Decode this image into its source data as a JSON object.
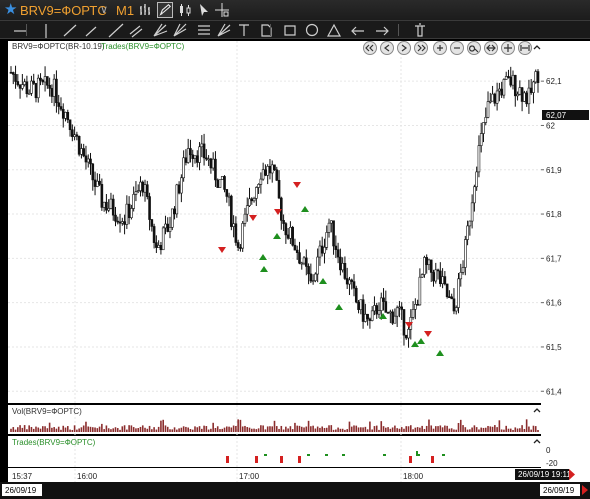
{
  "window": {
    "symbol": "BRV9=ФОРТС",
    "timeframe": "M1"
  },
  "main_pane": {
    "instrument_label": "BRV9=ФОРТС(BR-10.19)",
    "trades_label": "Trades(BRV9=ФОРТС)",
    "last_price": "62,07",
    "price_ticks": [
      "62,1",
      "62",
      "61,9",
      "61,8",
      "61,7",
      "61,6",
      "61,5",
      "61,4"
    ]
  },
  "vol_pane": {
    "label": "Vol(BRV9=ФОРТС)"
  },
  "trades_pane": {
    "label": "Trades(BRV9=ФОРТС)",
    "ticks": [
      "0",
      "-20"
    ]
  },
  "time_axis": {
    "start_label": "15:37",
    "ticks": [
      "16:00",
      "17:00",
      "18:00"
    ],
    "cursor_time": "26/09/19 19:11",
    "start_date": "26/09/19",
    "end_date": "26/09/19"
  },
  "colors": {
    "accent": "#f0a030",
    "up_marker": "#1e8f1e",
    "down_marker": "#d42020",
    "candle": "#e8e8e8",
    "volume": "#8b2d2d"
  },
  "toolbar_icons": [
    "bar-chart-icon",
    "pencil-icon",
    "candles-icon",
    "cursor-icon",
    "crosshair-icon"
  ],
  "drawing_tools": [
    "horizontal-line-icon",
    "vertical-line-icon",
    "trend-line-icon",
    "ray-icon",
    "extended-line-icon",
    "parallel-channel-icon",
    "andrews-pitchfork-icon",
    "gann-fan-icon",
    "fibonacci-icon",
    "fibonacci-fan-icon",
    "text-icon",
    "price-label-icon",
    "rectangle-icon",
    "ellipse-icon",
    "triangle-icon",
    "arrow-left-icon",
    "arrow-right-icon",
    "trash-icon"
  ],
  "nav_buttons": [
    "scroll-start-icon",
    "scroll-left-icon",
    "scroll-right-icon",
    "scroll-end-icon",
    "zoom-in-icon",
    "zoom-out-icon",
    "zoom-fit-icon",
    "compress-icon",
    "expand-icon",
    "fit-width-icon"
  ]
}
